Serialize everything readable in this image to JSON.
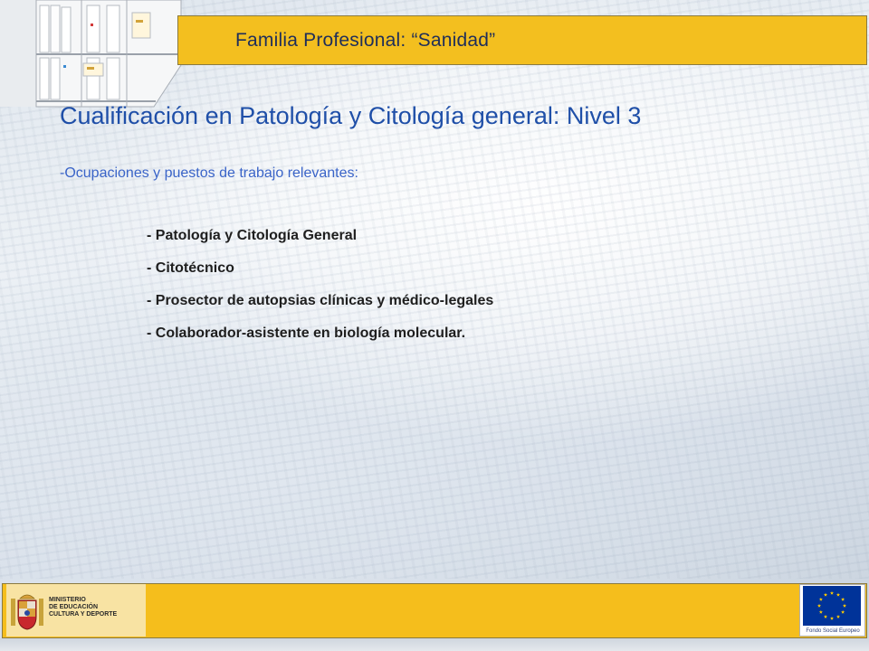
{
  "header": {
    "title": "Familia Profesional: “Sanidad”"
  },
  "main": {
    "title": "Cualificación en Patología y Citología general: Nivel 3",
    "subtitle": "-Ocupaciones y puestos de trabajo relevantes:",
    "occupations": [
      "- Patología y Citología General",
      "- Citotécnico",
      "- Prosector de autopsias clínicas y médico-legales",
      "- Colaborador-asistente en biología molecular."
    ]
  },
  "footer": {
    "ministry": [
      "MINISTERIO",
      "DE EDUCACIÓN",
      "CULTURA Y DEPORTE"
    ],
    "eu_caption": "Fondo Social Europeo"
  },
  "colors": {
    "header_bar": "#f3bf1f",
    "title": "#1f4fa8",
    "subtitle": "#3a64c8",
    "eu_blue": "#003399",
    "eu_star": "#ffcc00"
  },
  "icons": {
    "shelf": "bookshelf-icon",
    "ministry_logo": "coat-of-arms-icon",
    "eu_logo": "eu-flag-icon"
  }
}
